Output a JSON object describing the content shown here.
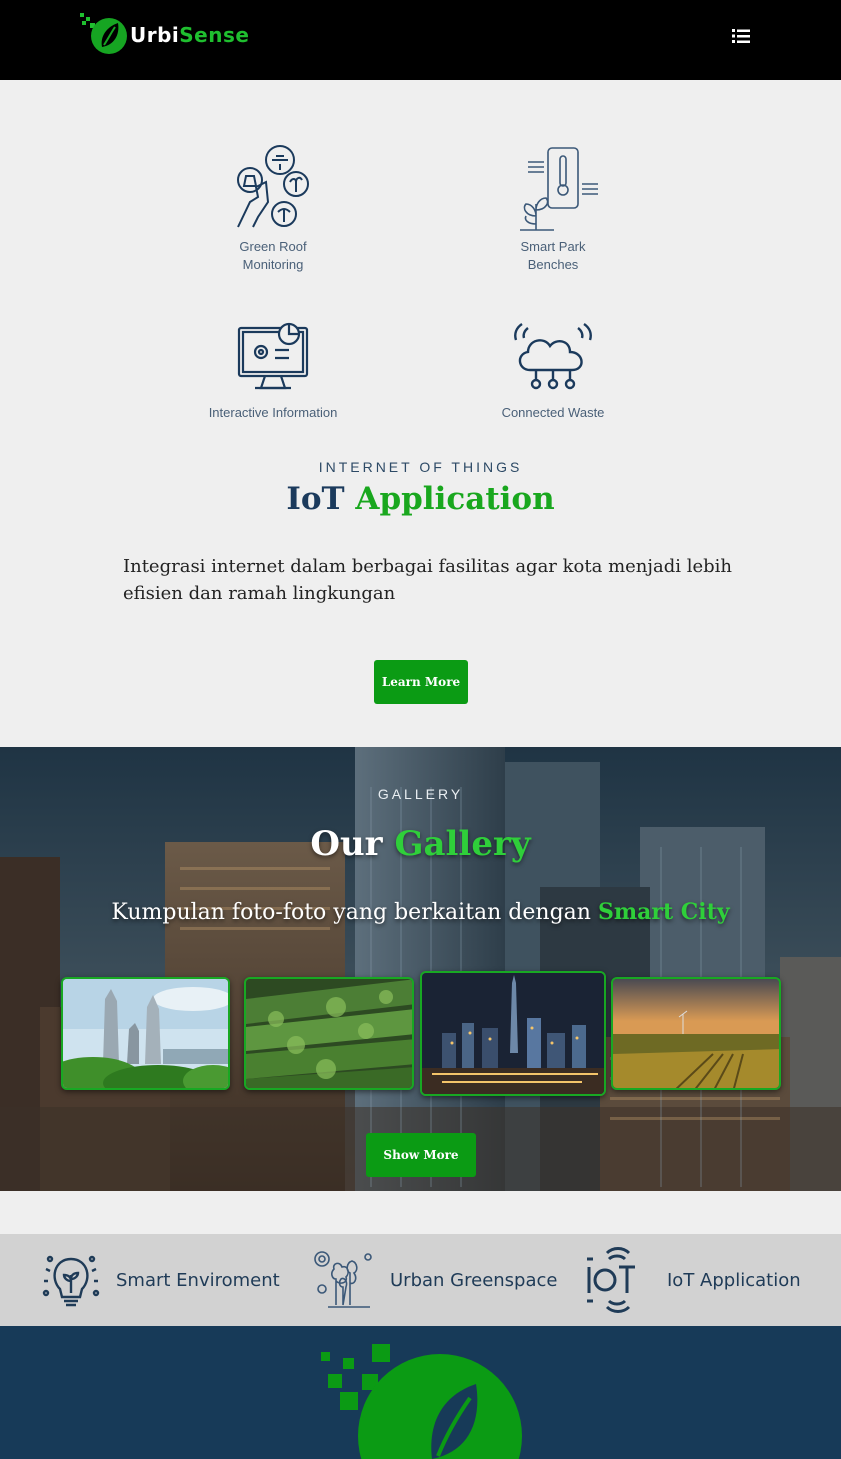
{
  "brand": {
    "part1": "Urbi",
    "part2": "Se",
    "part3": "nse",
    "menu_icon": "list-icon"
  },
  "features": [
    {
      "label_line1": "Green Roof",
      "label_line2": "Monitoring",
      "icon": "green-roof-icon"
    },
    {
      "label_line1": "Smart Park",
      "label_line2": "Benches",
      "icon": "smart-park-icon"
    },
    {
      "label_line1": "Interactive Information",
      "label_line2": "",
      "icon": "monitor-icon"
    },
    {
      "label_line1": "Connected Waste",
      "label_line2": "",
      "icon": "cloud-network-icon"
    }
  ],
  "iot": {
    "eyebrow": "INTERNET OF THINGS",
    "title_main": "IoT",
    "title_accent": "Application",
    "description": "Integrasi internet dalam berbagai fasilitas agar kota menjadi lebih efisien dan ramah lingkungan",
    "button": "Learn More"
  },
  "gallery": {
    "eyebrow": "GALLERY",
    "title_main": "Our",
    "title_accent": "Gallery",
    "subtitle_main": "Kumpulan foto-foto yang berkaitan dengan",
    "subtitle_accent": "Smart City",
    "button": "Show More"
  },
  "categories": [
    {
      "label": "Smart Enviroment",
      "icon": "lightbulb-plant-icon"
    },
    {
      "label": "Urban Greenspace",
      "icon": "trees-icon"
    },
    {
      "label": "IoT Application",
      "icon": "iot-icon"
    }
  ],
  "colors": {
    "accent_green": "#0b9b14",
    "navy": "#1b3a5c",
    "footer": "#173a58"
  }
}
